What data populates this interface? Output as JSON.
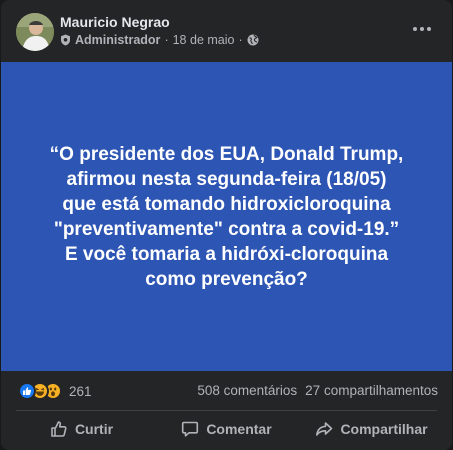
{
  "post": {
    "author": "Mauricio Negrao",
    "role": "Administrador",
    "date": "18 de maio",
    "separator": "·",
    "text_lines": [
      "“O presidente dos EUA, Donald Trump,",
      "afirmou nesta segunda-feira (18/05)",
      "que está tomando hidroxicloroquina",
      "\"preventivamente\" contra a covid-19.”",
      "E você tomaria a hidróxi-cloroquina",
      "como prevenção?"
    ],
    "image_bg_color": "#2d55b4"
  },
  "stats": {
    "reaction_count": "261",
    "reactions": [
      "like",
      "haha",
      "wow"
    ],
    "comments": "508 comentários",
    "shares": "27 compartilhamentos"
  },
  "actions": {
    "like_label": "Curtir",
    "comment_label": "Comentar",
    "share_label": "Compartilhar"
  },
  "icons": {
    "role": "admin-badge-icon",
    "privacy": "globe-icon",
    "more": "more-horizontal-icon"
  }
}
